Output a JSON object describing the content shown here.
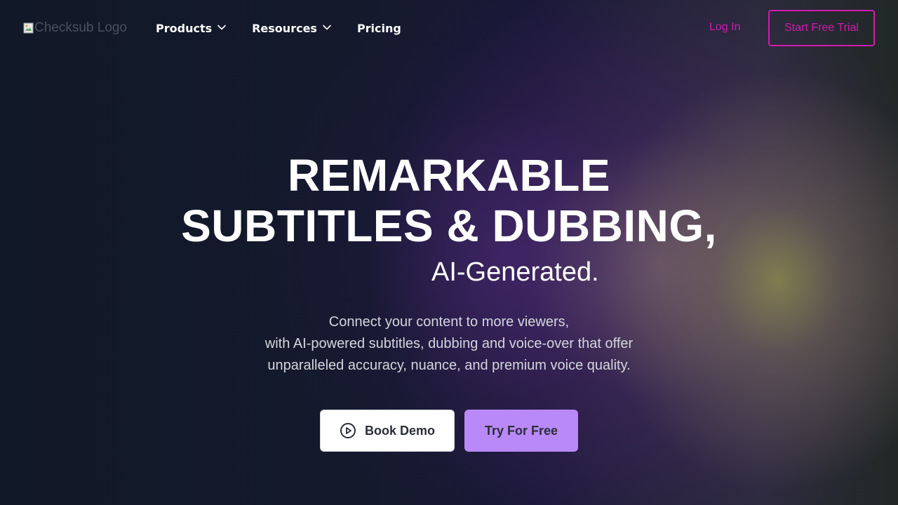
{
  "header": {
    "logo_alt": "Checksub Logo",
    "nav": [
      {
        "label": "Products",
        "has_dropdown": true,
        "icon": "chevron-down-icon"
      },
      {
        "label": "Resources",
        "has_dropdown": true,
        "icon": "chevron-down-icon"
      },
      {
        "label": "Pricing",
        "has_dropdown": false
      }
    ],
    "login_label": "Log In",
    "trial_label": "Start Free Trial"
  },
  "hero": {
    "title_line1": "REMARKABLE",
    "title_line2": "SUBTITLES & DUBBING,",
    "subtitle": "AI-Generated.",
    "description": [
      "Connect your content to more viewers,",
      "with AI-powered subtitles, dubbing and voice-over that offer",
      "unparalleled accuracy, nuance, and premium voice quality."
    ],
    "demo_button": {
      "label": "Book Demo",
      "icon": "play-circle-icon"
    },
    "try_button": {
      "label": "Try For Free"
    }
  },
  "colors": {
    "accent_magenta": "#d21ab0",
    "button_purple": "#b98af7",
    "background": "#121826"
  }
}
